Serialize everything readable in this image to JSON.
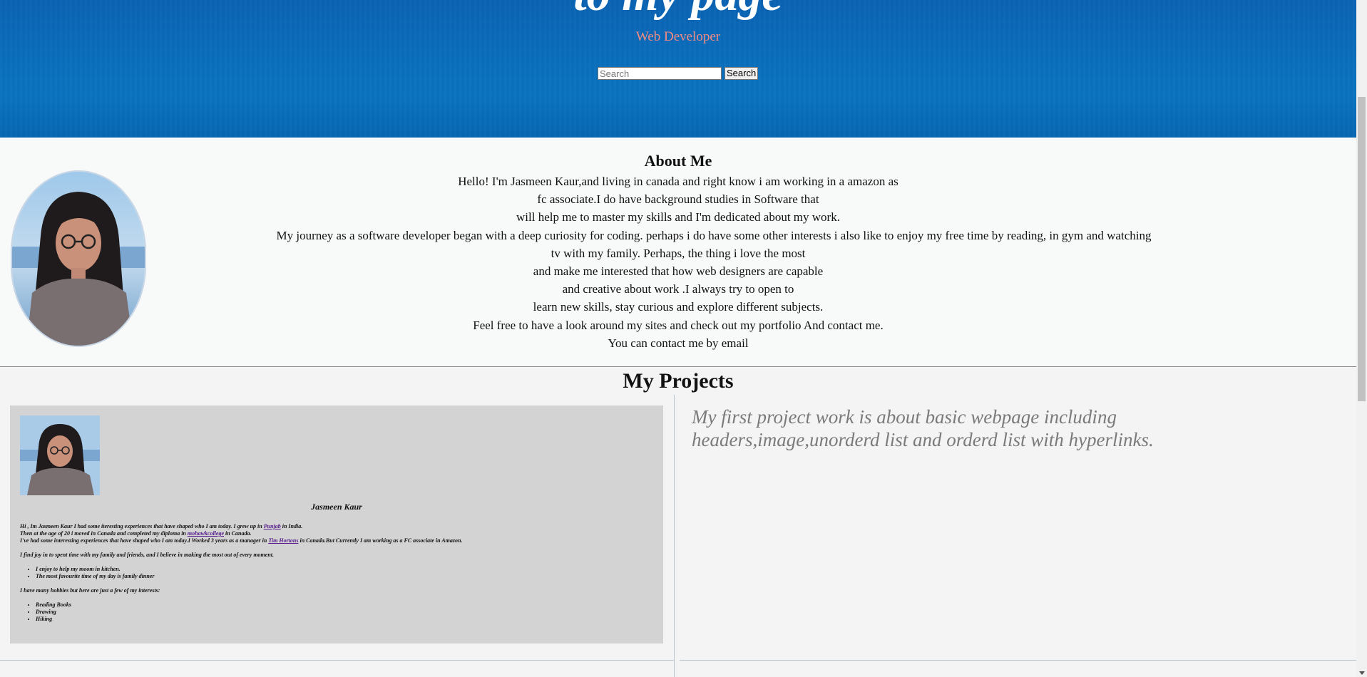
{
  "hero": {
    "title": "to my page",
    "subtitle": "Web Developer",
    "search_placeholder": "Search",
    "search_button": "Search",
    "colors": {
      "background": "#0a6fbd",
      "subtitle": "#f28b82"
    }
  },
  "about": {
    "title": "About Me",
    "lines": [
      "Hello! I'm Jasmeen Kaur,and living in canada and right know i am working in a amazon as",
      "fc associate.I do have background studies in Software that",
      "will help me to master my skills and I'm dedicated about my work.",
      "My journey as a software developer began with a deep curiosity for coding. perhaps i do have some other interests i also like to enjoy my free time by reading, in gym and watching",
      "tv with my family. Perhaps, the thing i love the most",
      "and make me interested that how web designers are capable",
      "and creative about work .I always try to open to",
      "learn new skills, stay curious and explore different subjects.",
      "Feel free to have a look around my sites and check out my portfolio And contact me.",
      "You can contact me by email"
    ]
  },
  "projects": {
    "title": "My Projects",
    "card": {
      "name": "Jasmeen Kaur",
      "p1_a": "Hi , Im Jasmeen Kaur I had some iteresting experiences that have shaped who I am today. I grew up in ",
      "p1_link": "Punjab",
      "p1_b": " in India.",
      "p2_a": "Then at the age of 20 i moved in Canada and completed my diploma in ",
      "p2_link": "mohawkcollege",
      "p2_b": " in Canada.",
      "p3_a": "I've had some interesting experiences that have shaped who I am today.I Worked 3 years as a manager in ",
      "p3_link": "Tim Hortons",
      "p3_b": " in Canada.But Currently I am working as a FC associate in Amazon.",
      "p4": "I find joy in to spent time with my family and friends, and I believe in making the most out of every moment.",
      "list1": [
        "I enjoy to help my moom in kitchen.",
        "The most favourite time of my day is family dinner"
      ],
      "p5": "I have many hobbies but here are just a few of my interests:",
      "list2": [
        "Reading Books",
        "Drawing",
        "Hiking"
      ]
    },
    "description": "My first project work is about basic webpage including headers,image,unorderd list and orderd list with hyperlinks."
  }
}
